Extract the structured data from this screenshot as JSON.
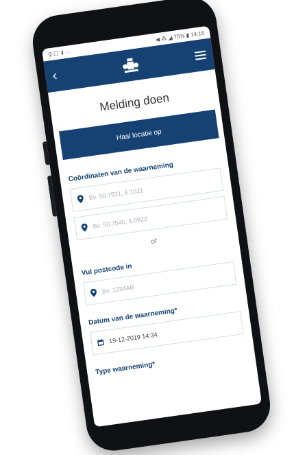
{
  "statusbar": {
    "left": "⚲ ☐ ⬇ ···",
    "right": "◀ ⁂ ◢ 75% ▮ 14:15"
  },
  "appbar": {
    "back_icon": "chevron-left-icon",
    "logo_icon": "coat-of-arms-icon",
    "menu_icon": "hamburger-menu-icon",
    "color": "#154273"
  },
  "page": {
    "title": "Melding doen"
  },
  "actions": {
    "locate_label": "Haal locatie op"
  },
  "coordinates": {
    "label": "Coördinaten van de waarneming",
    "field1_placeholder": "Bv. 50.7531, 6.1021",
    "field2_placeholder": "Bv. 50.7546, 6.0922"
  },
  "separator": {
    "or_text": "of"
  },
  "postcode": {
    "label": "Vul postcode in",
    "placeholder": "Bv. 1234AB"
  },
  "date": {
    "label": "Datum van de waarneming*",
    "value": "19-12-2019 14:34"
  },
  "type": {
    "label": "Type waarneming*"
  }
}
